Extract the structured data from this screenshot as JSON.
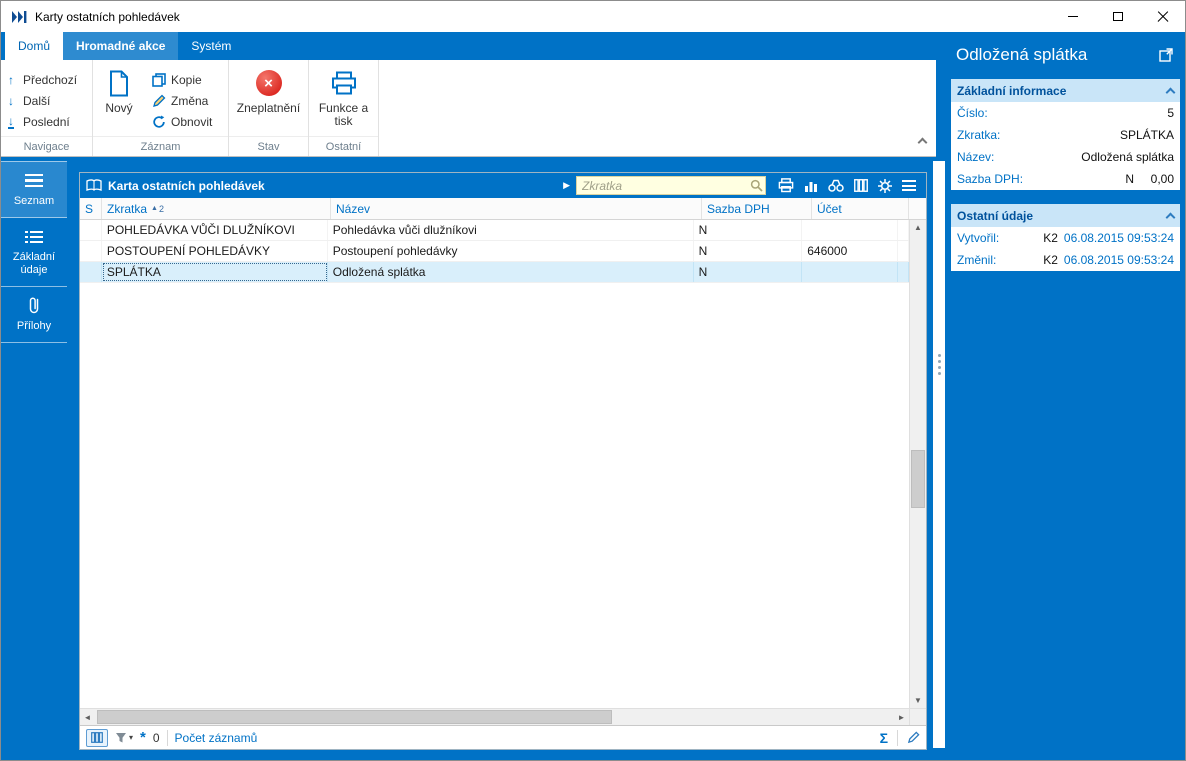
{
  "window": {
    "title": "Karty ostatních pohledávek"
  },
  "icons": {
    "prev": "↑",
    "next": "↓",
    "last": "↓",
    "play": "▶",
    "scroll_up": "▲",
    "scroll_down": "▼",
    "scroll_left": "◄",
    "scroll_right": "►",
    "dropdown": "▾",
    "asterisk": "*"
  },
  "ribbon": {
    "tabs": [
      {
        "label": "Domů"
      },
      {
        "label": "Hromadné akce"
      },
      {
        "label": "Systém"
      }
    ],
    "groups": {
      "navigace": {
        "label": "Navigace",
        "items": [
          {
            "label": "Předchozí"
          },
          {
            "label": "Další"
          },
          {
            "label": "Poslední"
          }
        ]
      },
      "zaznam": {
        "label": "Záznam",
        "new_label": "Nový",
        "items": [
          {
            "label": "Kopie"
          },
          {
            "label": "Změna"
          },
          {
            "label": "Obnovit"
          }
        ]
      },
      "stav": {
        "label": "Stav",
        "button": "Zneplatnění"
      },
      "ostatni": {
        "label": "Ostatní",
        "button": "Funkce a tisk"
      }
    }
  },
  "sidebar": {
    "items": [
      {
        "label": "Seznam"
      },
      {
        "label": "Základní údaje"
      },
      {
        "label": "Přílohy"
      }
    ]
  },
  "browse": {
    "title": "Karta ostatních pohledávek",
    "search_placeholder": "Zkratka",
    "columns": {
      "s": "S",
      "zkratka": "Zkratka",
      "nazev": "Název",
      "dph": "Sazba DPH",
      "ucet": "Účet"
    },
    "sort": {
      "arrow": "▲",
      "order": "2"
    },
    "rows": [
      {
        "zkratka": "POHLEDÁVKA VŮČI DLUŽNÍKOVI",
        "nazev": "Pohledávka vůči dlužníkovi",
        "dph": "N",
        "ucet": ""
      },
      {
        "zkratka": "POSTOUPENÍ POHLEDÁVKY",
        "nazev": "Postoupení pohledávky",
        "dph": "N",
        "ucet": "646000"
      },
      {
        "zkratka": "SPLÁTKA",
        "nazev": "Odložená splátka",
        "dph": "N",
        "ucet": ""
      }
    ],
    "status": {
      "count": "0",
      "records_label": "Počet záznamů",
      "sigma": "Σ"
    }
  },
  "detail": {
    "title": "Odložená splátka",
    "sections": [
      {
        "title": "Základní informace",
        "fields": [
          {
            "label": "Číslo:",
            "value": "5"
          },
          {
            "label": "Zkratka:",
            "value": "SPLÁTKA"
          },
          {
            "label": "Název:",
            "value": "Odložená splátka"
          },
          {
            "label": "Sazba DPH:",
            "value": "N",
            "value2": "0,00"
          }
        ]
      },
      {
        "title": "Ostatní údaje",
        "fields": [
          {
            "label": "Vytvořil:",
            "value": "K2",
            "value2": "06.08.2015 09:53:24"
          },
          {
            "label": "Změnil:",
            "value": "K2",
            "value2": "06.08.2015 09:53:24"
          }
        ]
      }
    ]
  },
  "colors": {
    "accent": "#0072C6",
    "selection": "#D9EFFB",
    "section_header_bg": "#C9E5F8",
    "search_bg": "#FFFFE1"
  }
}
